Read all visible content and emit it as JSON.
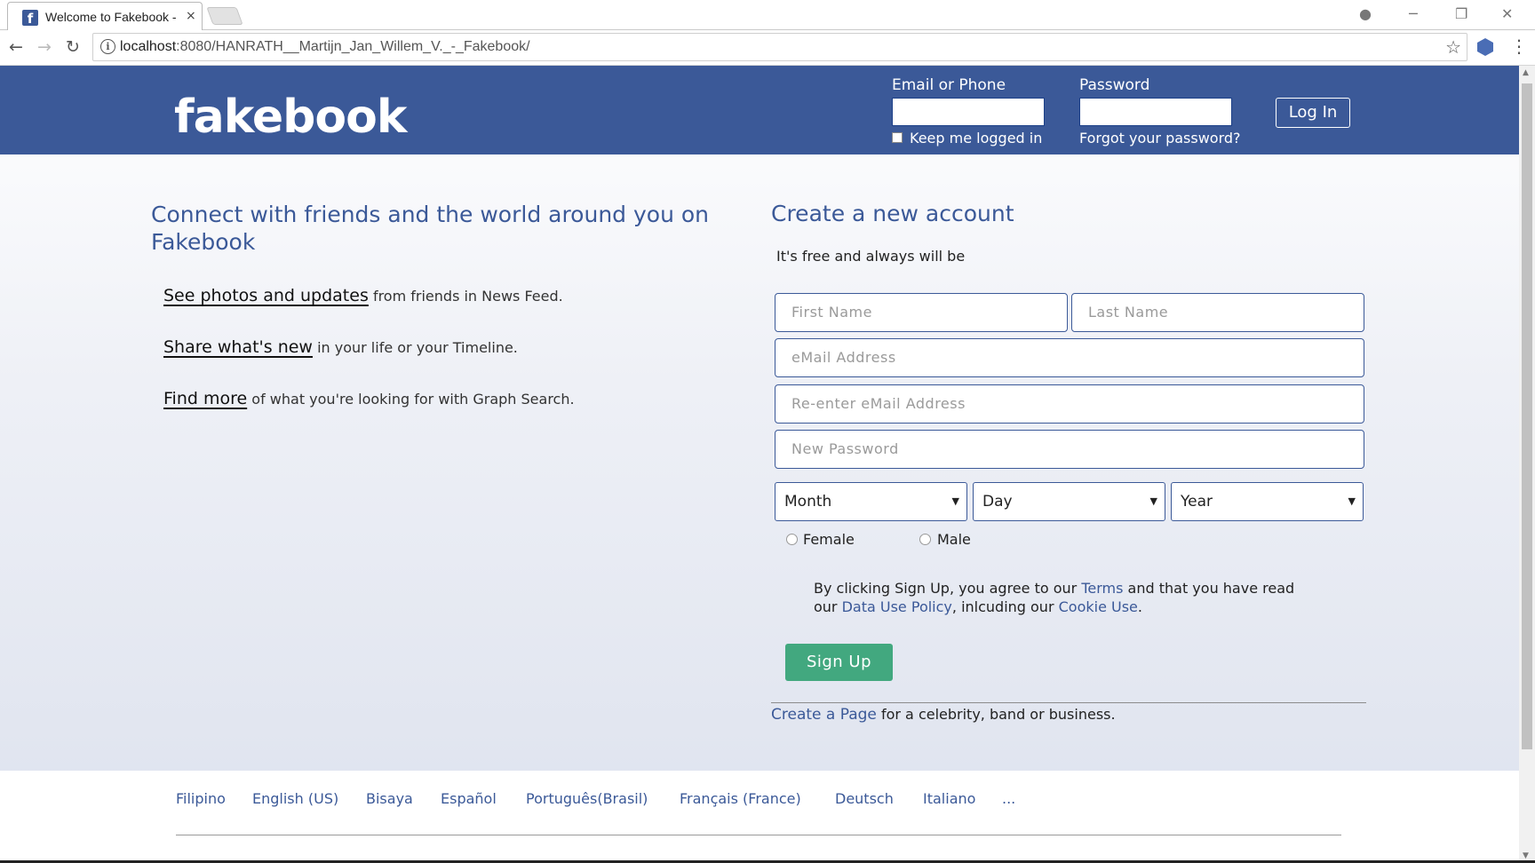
{
  "browser": {
    "tab_title": "Welcome to Fakebook -",
    "favicon_letter": "f",
    "tab_close": "×",
    "url_host": "localhost",
    "url_path": ":8080/HANRATH__Martijn_Jan_Willem_V._-_Fakebook/",
    "back": "←",
    "forward": "→",
    "reload": "↻",
    "info": "i",
    "star": "☆",
    "menu": "⋮",
    "account_icon": "●",
    "minimize": "─",
    "restore": "❐",
    "close": "✕"
  },
  "header": {
    "logo": "fakebook",
    "email_label": "Email or Phone",
    "password_label": "Password",
    "login_button": "Log In",
    "keep_logged_in": "Keep me logged in",
    "forgot_password": "Forgot your password?"
  },
  "left": {
    "heading": "Connect with friends and the world around you on Fakebook",
    "features": [
      {
        "strong": "See photos and updates",
        "rest": " from friends in News Feed."
      },
      {
        "strong": "Share what's new",
        "rest": " in your life or your Timeline."
      },
      {
        "strong": "Find more",
        "rest": " of what you're looking for with Graph Search."
      }
    ]
  },
  "signup": {
    "heading": "Create a new account",
    "subheading": "It's free and always will be",
    "first_name": "First Name",
    "last_name": "Last Name",
    "email": "eMail Address",
    "reenter_email": "Re-enter eMail Address",
    "new_password": "New Password",
    "month": "Month",
    "day": "Day",
    "year": "Year",
    "female": "Female",
    "male": "Male",
    "terms_1": "By clicking Sign Up, you agree to our ",
    "terms_link": "Terms",
    "terms_2": " and that you have read our ",
    "data_policy_link": "Data Use Policy",
    "terms_3": ", inlcuding our ",
    "cookie_link": "Cookie Use",
    "terms_4": ".",
    "signup_button": "Sign Up",
    "create_page_link": "Create a Page",
    "create_page_rest": " for a celebrity, band or business."
  },
  "footer": {
    "languages": [
      "Filipino",
      "English (US)",
      "Bisaya",
      "Español",
      "Português(Brasil)",
      "Français (France)",
      "Deutsch",
      "Italiano",
      "..."
    ]
  }
}
